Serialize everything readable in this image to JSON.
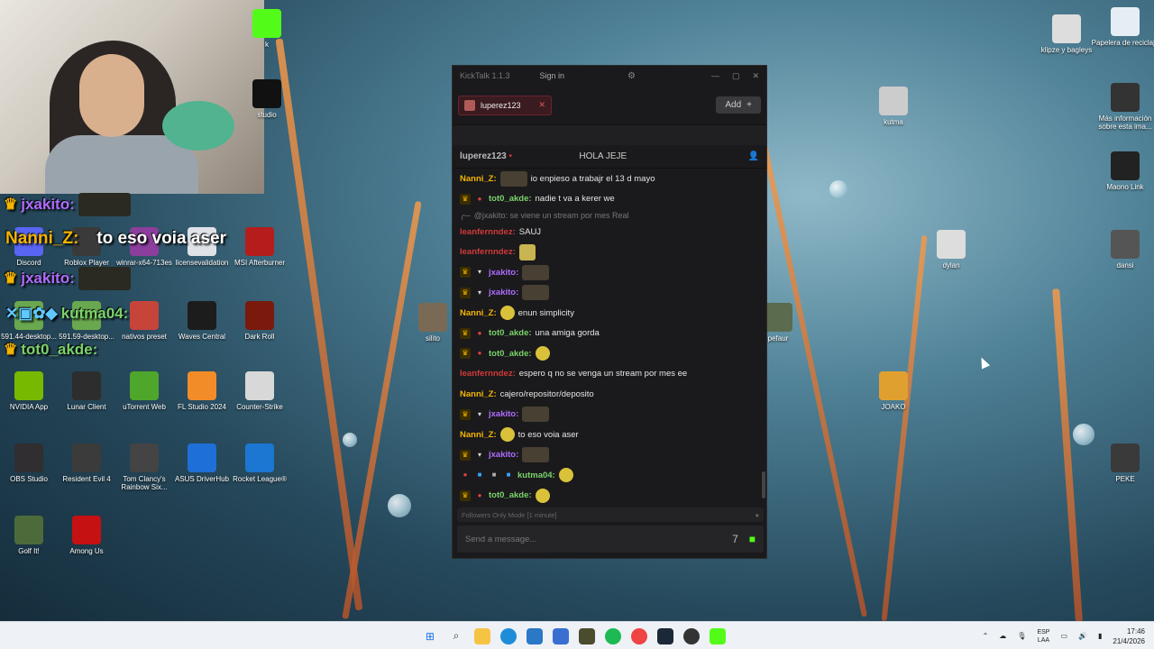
{
  "desktop": {
    "icons_left": [
      {
        "label": "Discord",
        "icon": "discord-icon",
        "color": "#5865f2"
      },
      {
        "label": "Roblox Player",
        "icon": "roblox-icon",
        "color": "#3a3a3a"
      },
      {
        "label": "winrar-x64-713es",
        "icon": "winrar-icon",
        "color": "#8b3e9c"
      },
      {
        "label": "licensevalidation",
        "icon": "document-icon",
        "color": "#dfe3e8"
      },
      {
        "label": "MSI Afterburner",
        "icon": "msi-icon",
        "color": "#b51d1d"
      },
      {
        "label": "591.44-desktop...",
        "icon": "nvidia-installer-icon",
        "color": "#6aa84f"
      },
      {
        "label": "591.59-desktop...",
        "icon": "nvidia-installer-icon",
        "color": "#6aa84f"
      },
      {
        "label": "nativos preset",
        "icon": "preset-icon",
        "color": "#c6443a"
      },
      {
        "label": "Waves Central",
        "icon": "waves-icon",
        "color": "#1c1c1c"
      },
      {
        "label": "Dark Roll",
        "icon": "dark-roll-icon",
        "color": "#7a1a0c"
      },
      {
        "label": "NVIDIA App",
        "icon": "nvidia-icon",
        "color": "#76b900"
      },
      {
        "label": "Lunar Client",
        "icon": "lunar-icon",
        "color": "#2d2d2d"
      },
      {
        "label": "uTorrent Web",
        "icon": "utorrent-icon",
        "color": "#4ea62b"
      },
      {
        "label": "FL Studio 2024",
        "icon": "fl-studio-icon",
        "color": "#f28c28"
      },
      {
        "label": "Counter-Strike",
        "icon": "counter-strike-icon",
        "color": "#d8d8d8"
      },
      {
        "label": "OBS Studio",
        "icon": "obs-icon",
        "color": "#302e31"
      },
      {
        "label": "Resident Evil 4",
        "icon": "re4-icon",
        "color": "#3b3b3b"
      },
      {
        "label": "Tom Clancy's Rainbow Six...",
        "icon": "r6-icon",
        "color": "#444"
      },
      {
        "label": "ASUS DriverHub",
        "icon": "asus-icon",
        "color": "#1e6fd8"
      },
      {
        "label": "Rocket League®",
        "icon": "rocket-league-icon",
        "color": "#1b77d1"
      },
      {
        "label": "Golf It!",
        "icon": "golf-icon",
        "color": "#4d6b3a"
      },
      {
        "label": "Among Us",
        "icon": "among-us-icon",
        "color": "#c51111"
      }
    ],
    "icons_right": [
      {
        "label": "klipze y bagleys",
        "icon": "photo-icon",
        "color": "#dddddd"
      },
      {
        "label": "Papelera de reciclaje",
        "icon": "recycle-bin-icon",
        "color": "#e6eef5"
      },
      {
        "label": "kutma",
        "icon": "photo-icon",
        "color": "#ccc"
      },
      {
        "label": "Más información sobre esta ima...",
        "icon": "info-icon",
        "color": "#333"
      },
      {
        "label": "Maono Link",
        "icon": "maono-icon",
        "color": "#222"
      },
      {
        "label": "dylan",
        "icon": "photo-icon",
        "color": "#ddd"
      },
      {
        "label": "dansi",
        "icon": "photo-icon",
        "color": "#555"
      },
      {
        "label": "silito",
        "icon": "photo-icon",
        "color": "#7a6a55"
      },
      {
        "label": "pefaur",
        "icon": "photo-icon",
        "color": "#5a6b4e"
      },
      {
        "label": "JOAKO",
        "icon": "stumble-icon",
        "color": "#e0a030"
      },
      {
        "label": "PEKE",
        "icon": "photo-icon",
        "color": "#3a3a3a"
      },
      {
        "label": "k",
        "icon": "kick-icon",
        "color": "#53fc18"
      },
      {
        "label": "studio",
        "icon": "studio-icon",
        "color": "#111"
      }
    ]
  },
  "overlay": [
    {
      "user": "jxakito:",
      "color": "#b06cff"
    },
    {
      "user": "Nanni_Z:",
      "color": "#f4b400",
      "text": "to eso voia aser"
    },
    {
      "user": "jxakito:",
      "color": "#b06cff"
    },
    {
      "user": "kutma04:",
      "color": "#7bd36b"
    },
    {
      "user": "tot0_akde:",
      "color": "#7bd36b"
    }
  ],
  "kicktalk": {
    "title": "KickTalk 1.1.3",
    "signin": "Sign in",
    "tab": "luperez123",
    "add_label": "Add",
    "channel": "luperez123",
    "pinned": "HOLA JEJE",
    "messages": [
      {
        "user": "Nanni_Z:",
        "color": "#f4b400",
        "text": "io enpieso a trabajr el 13 d mayo",
        "badges": [],
        "emote": "wide"
      },
      {
        "user": "tot0_akde:",
        "color": "#7bd36b",
        "text": "nadie t va a kerer we",
        "badges": [
          "crown",
          "red"
        ]
      },
      {
        "reply": "@jxakito: se viene un stream por mes Real"
      },
      {
        "user": "leanfernndez:",
        "color": "#d23a3a",
        "text": "SAUJ",
        "badges": []
      },
      {
        "user": "leanfernndez:",
        "color": "#d23a3a",
        "text": "",
        "badges": [],
        "emote": "square"
      },
      {
        "user": "jxakito:",
        "color": "#b06cff",
        "text": "",
        "badges": [
          "crown",
          "glass"
        ],
        "emote": "wide"
      },
      {
        "user": "jxakito:",
        "color": "#b06cff",
        "text": "",
        "badges": [
          "crown",
          "glass"
        ],
        "emote": "wide"
      },
      {
        "user": "Nanni_Z:",
        "color": "#f4b400",
        "text": "enun simplicity",
        "badges": [],
        "emote": "small"
      },
      {
        "user": "tot0_akde:",
        "color": "#7bd36b",
        "text": "una amiga gorda",
        "badges": [
          "crown",
          "red"
        ]
      },
      {
        "user": "tot0_akde:",
        "color": "#7bd36b",
        "text": "",
        "badges": [
          "crown",
          "red"
        ],
        "emote": "small"
      },
      {
        "user": "leanfernndez:",
        "color": "#d23a3a",
        "text": "espero q no se venga un stream por mes ee",
        "badges": []
      },
      {
        "user": "Nanni_Z:",
        "color": "#f4b400",
        "text": "cajero/repositor/deposito",
        "badges": []
      },
      {
        "user": "jxakito:",
        "color": "#b06cff",
        "text": "",
        "badges": [
          "crown",
          "glass"
        ],
        "emote": "wide"
      },
      {
        "user": "Nanni_Z:",
        "color": "#f4b400",
        "text": "to eso voia aser",
        "badges": [],
        "emote": "small"
      },
      {
        "user": "jxakito:",
        "color": "#b06cff",
        "text": "",
        "badges": [
          "crown",
          "glass"
        ],
        "emote": "wide"
      },
      {
        "user": "kutma04:",
        "color": "#7bd36b",
        "text": "",
        "badges": [
          "red",
          "blue",
          "gray",
          "blue"
        ],
        "emote": "small"
      },
      {
        "user": "tot0_akde:",
        "color": "#7bd36b",
        "text": "",
        "badges": [
          "crown",
          "red"
        ],
        "emote": "small"
      }
    ],
    "status": "Followers Only Mode [1 minute]",
    "input_placeholder": "Send a message..."
  },
  "taskbar": {
    "lang_top": "ESP",
    "lang_bottom": "LAA",
    "time": "17:46",
    "date": "21/4/2026"
  }
}
